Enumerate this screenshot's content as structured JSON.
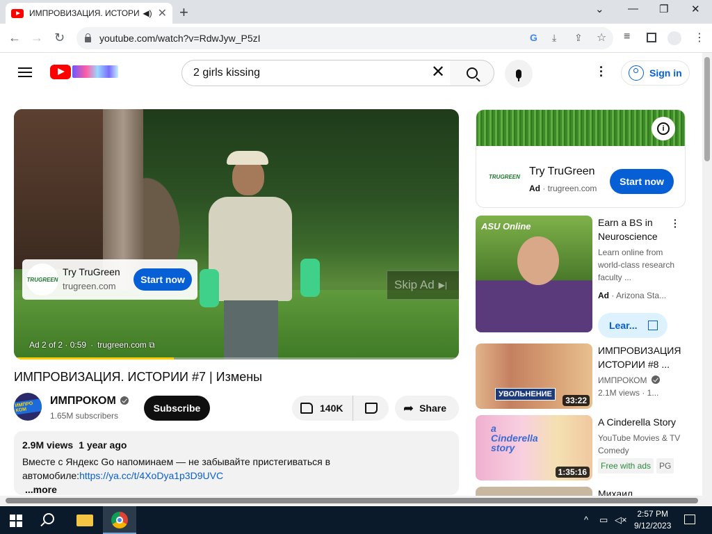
{
  "browser": {
    "tab_title": "ИМПРОВИЗАЦИЯ. ИСТОРИ",
    "new_tab": "+",
    "url": "youtube.com/watch?v=RdwJyw_P5zI",
    "window_controls": {
      "minimize": "—",
      "restore": "❐",
      "close": "✕",
      "dropdown": "⌄"
    },
    "nav": {
      "back": "←",
      "forward": "→",
      "reload": "↻"
    }
  },
  "youtube": {
    "search_query": "2 girls kissing",
    "sign_in": "Sign in"
  },
  "player": {
    "ad_card": {
      "logo": "TRUGREEN",
      "name": "Try TruGreen",
      "site": "trugreen.com",
      "button": "Start now"
    },
    "skip_label": "Skip Ad",
    "ad_position": "Ad 2 of 2 · 0:59",
    "ad_domain": "trugreen.com",
    "progress_fraction": 0.36,
    "progress_color": "#ffcc00"
  },
  "video": {
    "title": "ИМПРОВИЗАЦИЯ. ИСТОРИИ #7 | Измены",
    "channel": "ИМПРОКОМ",
    "channel_avatar_text": "ИМПРО КОМ",
    "subscribers": "1.65M subscribers",
    "subscribe_label": "Subscribe",
    "likes": "140K",
    "share_label": "Share",
    "views": "2.9M views",
    "age": "1 year ago",
    "description_line1": "Вместе с Яндекс Go напоминаем — не забывайте пристегиваться в",
    "description_line2_prefix": "автомобиле:",
    "description_link": "https://ya.cc/t/4XoDya1p3D9UVC",
    "more_label": "...more"
  },
  "sidebar": {
    "ad": {
      "logo": "TRUGREEN",
      "name": "Try TruGreen",
      "ad_label": "Ad",
      "site": "trugreen.com",
      "button": "Start now",
      "info": "i"
    },
    "items": [
      {
        "title": "Earn a BS in Neuroscience",
        "desc": "Learn online from world-class research faculty ...",
        "ad_label": "Ad",
        "advertiser": "Arizona Sta...",
        "button": "Lear...",
        "thumb_text": "ASU Online"
      },
      {
        "title": "ИМПРОВИЗАЦИЯ ИСТОРИИ #8 ...",
        "channel": "ИМПРОКОМ",
        "meta": "2.1M views · 1...",
        "duration": "33:22",
        "thumb_text": "УВОЛЬНЕНИЕ"
      },
      {
        "title": "A Cinderella Story",
        "channel": "YouTube Movies & TV",
        "genre": "Comedy",
        "badge_free": "Free with ads",
        "badge_rating": "PG",
        "duration": "1:35:16",
        "thumb_text": "a Cinderella story"
      },
      {
        "title": "Михаил"
      }
    ]
  },
  "taskbar": {
    "time": "2:57 PM",
    "date": "9/12/2023"
  },
  "colors": {
    "accent_blue": "#065fd4",
    "youtube_red": "#ff0000"
  }
}
